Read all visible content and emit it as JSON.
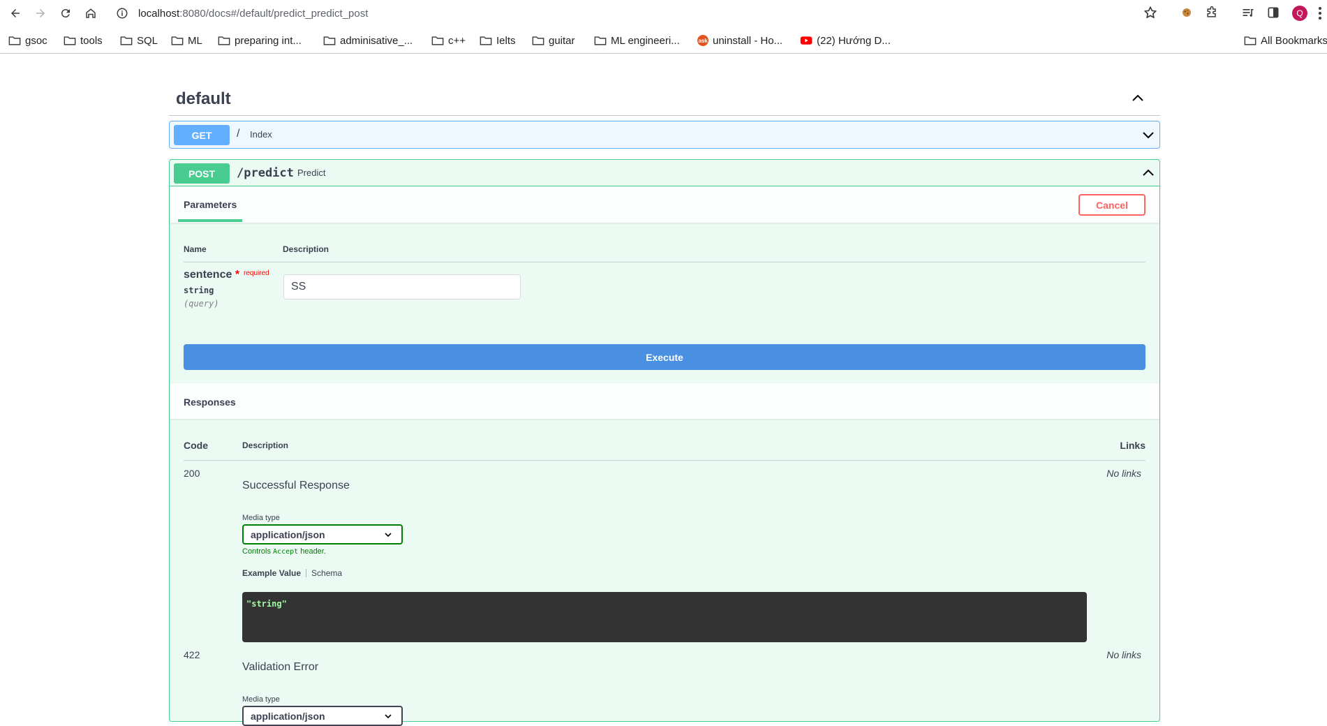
{
  "browser": {
    "url_host": "localhost",
    "url_rest": ":8080/docs#/default/predict_predict_post",
    "avatar_letter": "Q"
  },
  "bookmarks": [
    {
      "label": "gsoc",
      "type": "folder"
    },
    {
      "label": "tools",
      "type": "folder"
    },
    {
      "label": "SQL",
      "type": "folder"
    },
    {
      "label": "ML",
      "type": "folder"
    },
    {
      "label": "preparing int...",
      "type": "folder"
    },
    {
      "label": "adminisative_...",
      "type": "folder"
    },
    {
      "label": "c++",
      "type": "folder"
    },
    {
      "label": "Ielts",
      "type": "folder"
    },
    {
      "label": "guitar",
      "type": "folder"
    },
    {
      "label": "ML engineeri...",
      "type": "folder"
    },
    {
      "label": "uninstall - Ho...",
      "type": "site",
      "icon": "ask"
    },
    {
      "label": "(22) Hướng D...",
      "type": "site",
      "icon": "youtube"
    },
    {
      "label": "All Bookmarks",
      "type": "folder"
    }
  ],
  "section": {
    "title": "default"
  },
  "operations": {
    "get": {
      "method": "GET",
      "path": "/",
      "summary": "Index"
    },
    "post": {
      "method": "POST",
      "path": "/predict",
      "summary": "Predict"
    }
  },
  "parameters": {
    "tab_label": "Parameters",
    "cancel_label": "Cancel",
    "col_name": "Name",
    "col_description": "Description",
    "param": {
      "name": "sentence",
      "star": "*",
      "required_label": "required",
      "type": "string",
      "location": "(query)",
      "value": "SS"
    },
    "execute_label": "Execute"
  },
  "responses": {
    "title": "Responses",
    "col_code": "Code",
    "col_description": "Description",
    "col_links": "Links",
    "items": [
      {
        "code": "200",
        "description": "Successful Response",
        "links": "No links",
        "media_type_label": "Media type",
        "media_type": "application/json",
        "controls_prefix": "Controls ",
        "controls_code": "Accept",
        "controls_suffix": " header.",
        "example_tab": "Example Value",
        "schema_tab": "Schema",
        "example": "\"string\""
      },
      {
        "code": "422",
        "description": "Validation Error",
        "links": "No links",
        "media_type_label": "Media type",
        "media_type": "application/json"
      }
    ]
  },
  "colors": {
    "get": "#61affe",
    "post": "#49cc90",
    "execute": "#4990e2",
    "cancel": "#ff6060"
  }
}
